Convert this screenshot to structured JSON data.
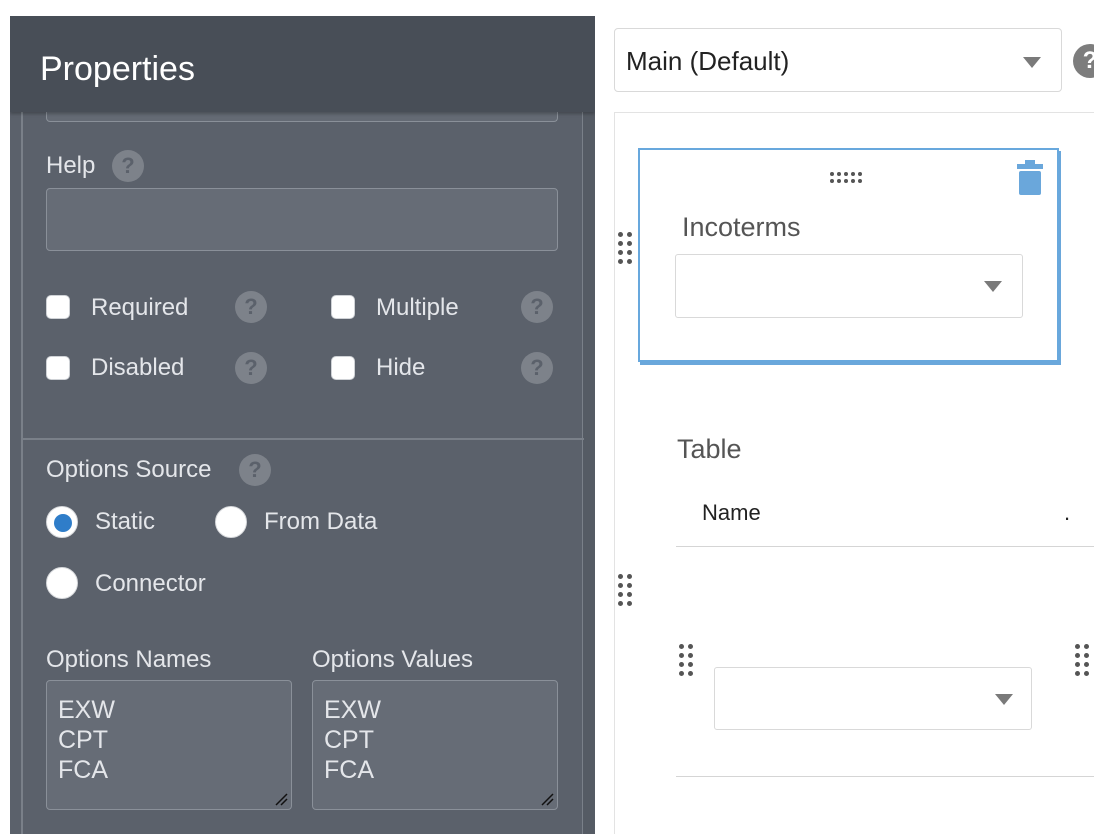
{
  "properties_panel": {
    "title": "Properties",
    "help": {
      "label": "Help",
      "value": ""
    },
    "checkboxes": [
      {
        "label": "Required",
        "checked": false
      },
      {
        "label": "Multiple",
        "checked": false
      },
      {
        "label": "Disabled",
        "checked": false
      },
      {
        "label": "Hide",
        "checked": false
      }
    ],
    "options_source": {
      "label": "Options Source",
      "options": [
        {
          "label": "Static",
          "selected": true
        },
        {
          "label": "From Data",
          "selected": false
        },
        {
          "label": "Connector",
          "selected": false
        }
      ]
    },
    "options_names": {
      "label": "Options Names",
      "lines": [
        "EXW",
        "CPT",
        "FCA"
      ]
    },
    "options_values": {
      "label": "Options Values",
      "lines": [
        "EXW",
        "CPT",
        "FCA"
      ]
    },
    "help_icon": "question-circle-icon"
  },
  "canvas": {
    "view_select": {
      "value": "Main (Default)",
      "icon": "chevron-down-icon"
    },
    "top_help_icon": "question-circle-icon",
    "selected_field": {
      "label": "Incoterms",
      "value": "",
      "delete_icon": "trash-icon",
      "drag_icon": "drag-handle-icon"
    },
    "table": {
      "label": "Table",
      "header": {
        "name": "Name",
        "extra": "."
      },
      "row_dropdown_value": ""
    }
  },
  "colors": {
    "panel_bg": "#5b616b",
    "panel_header_bg": "#484e57",
    "accent_blue": "#68a8dd",
    "radio_selected": "#2f7dc9"
  }
}
